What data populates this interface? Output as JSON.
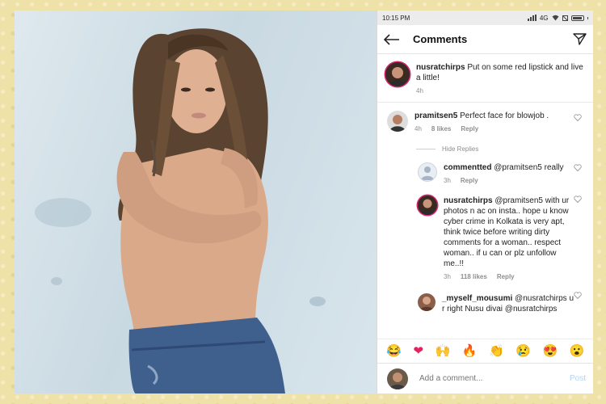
{
  "status_bar": {
    "time": "10:15 PM",
    "network": "4G"
  },
  "header": {
    "title": "Comments"
  },
  "caption": {
    "username": "nusratchirps",
    "text": "Put on some red lipstick and live a little!",
    "time": "4h"
  },
  "comments": [
    {
      "username": "pramitsen5",
      "text": "Perfect face for blowjob .",
      "time": "4h",
      "likes": "8 likes",
      "reply_label": "Reply"
    }
  ],
  "hide_replies_label": "Hide Replies",
  "replies": [
    {
      "username": "commentted",
      "text": "@pramitsen5 really",
      "time": "3h",
      "likes": "",
      "reply_label": "Reply"
    },
    {
      "username": "nusratchirps",
      "text": "@pramitsen5 with ur photos n ac on insta.. hope u know cyber crime in Kolkata is very apt, think twice before writing dirty comments for a woman.. respect woman.. if u can or plz unfollow me..!!",
      "time": "3h",
      "likes": "118 likes",
      "reply_label": "Reply"
    },
    {
      "username": "_myself_mousumi",
      "text": "@nusratchirps u r right Nusu divai @nusratchirps",
      "time": "",
      "likes": "",
      "reply_label": ""
    }
  ],
  "emojis": [
    "😂",
    "❤",
    "🙌",
    "🔥",
    "👏",
    "😢",
    "😍",
    "😮"
  ],
  "add_comment": {
    "placeholder": "Add a comment...",
    "post_label": "Post"
  },
  "colors": {
    "accent": "#0095f6",
    "post_disabled": "#b3d4f5",
    "frame": "#efe2a8",
    "ring": "#d62976"
  }
}
